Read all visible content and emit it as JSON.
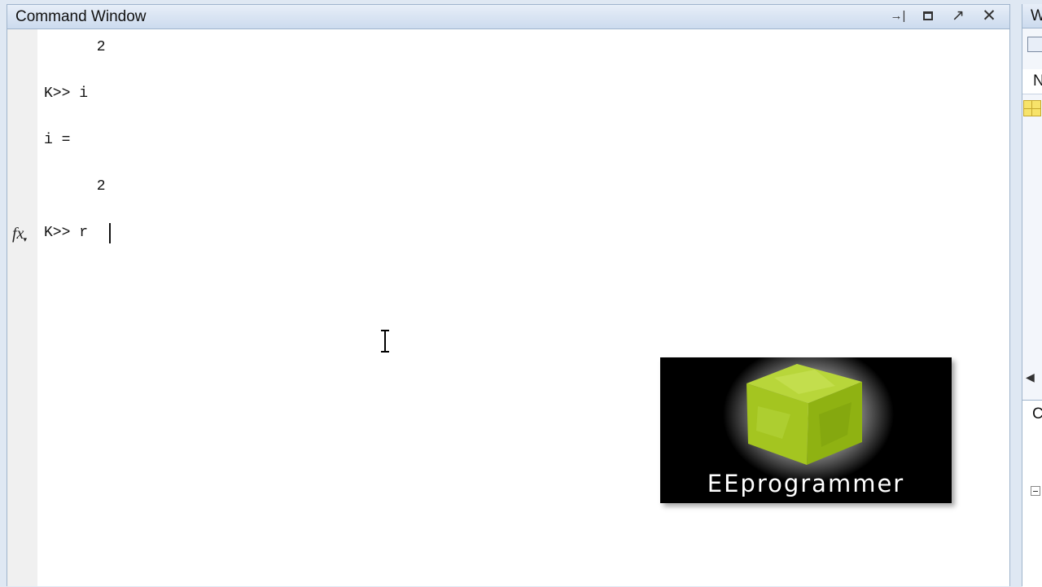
{
  "command_window": {
    "title": "Command Window",
    "controls": {
      "undock": "→|",
      "restore": "↗",
      "close": "✕"
    },
    "lines": [
      "      2",
      "K>> i",
      "i =",
      "      2",
      "K>> r"
    ],
    "fx_label": "fx",
    "fx_arrow": "▾"
  },
  "logo": {
    "text": "EEprogrammer"
  },
  "right_panel": {
    "top_title": "W",
    "header_letter": "N",
    "lower_label": "C",
    "scroll_arrow": "◀"
  },
  "colors": {
    "titlebar": "#ccdbee",
    "border": "#9fb4cc",
    "cube_green": "#9bc31b"
  }
}
